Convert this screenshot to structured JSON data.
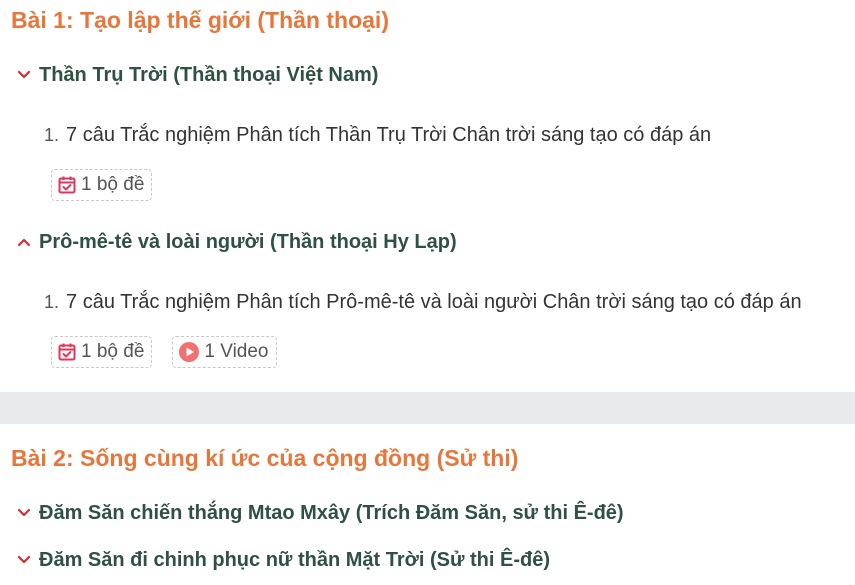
{
  "sections": [
    {
      "title": "Bài 1: Tạo lập thế giới (Thần thoại)",
      "topics": [
        {
          "title": "Thần Trụ Trời (Thần thoại Việt Nam)",
          "lessons": [
            {
              "num": "1.",
              "text": "7 câu Trắc nghiệm Phân tích Thần Trụ Trời Chân trời sáng tạo có đáp án"
            }
          ],
          "badges": [
            {
              "label": "1 bộ đề",
              "icon": "calendar-check-icon"
            }
          ]
        },
        {
          "title": "Prô-mê-tê và loài người (Thần thoại Hy Lạp)",
          "lessons": [
            {
              "num": "1.",
              "text": "7 câu Trắc nghiệm Phân tích Prô-mê-tê và loài người Chân trời sáng tạo có đáp án"
            }
          ],
          "badges": [
            {
              "label": "1 bộ đề",
              "icon": "calendar-check-icon"
            },
            {
              "label": "1 Video",
              "icon": "play-circle-icon"
            }
          ]
        }
      ]
    },
    {
      "title": "Bài 2: Sống cùng kí ức của cộng đồng (Sử thi)",
      "topics": [
        {
          "title": "Đăm Săn chiến thắng Mtao Mxây (Trích Đăm Săn, sử thi Ê-đê)"
        },
        {
          "title": "Đăm Săn đi chinh phục nữ thần Mặt Trời (Sử thi Ê-đê)"
        }
      ]
    }
  ],
  "colors": {
    "section_title": "#e8763a",
    "topic_title": "#2f5142",
    "chevron": "#d32f2f",
    "badge_icon": "#e0355a",
    "video_icon": "#f26f6f",
    "divider": "#e9eaee"
  }
}
